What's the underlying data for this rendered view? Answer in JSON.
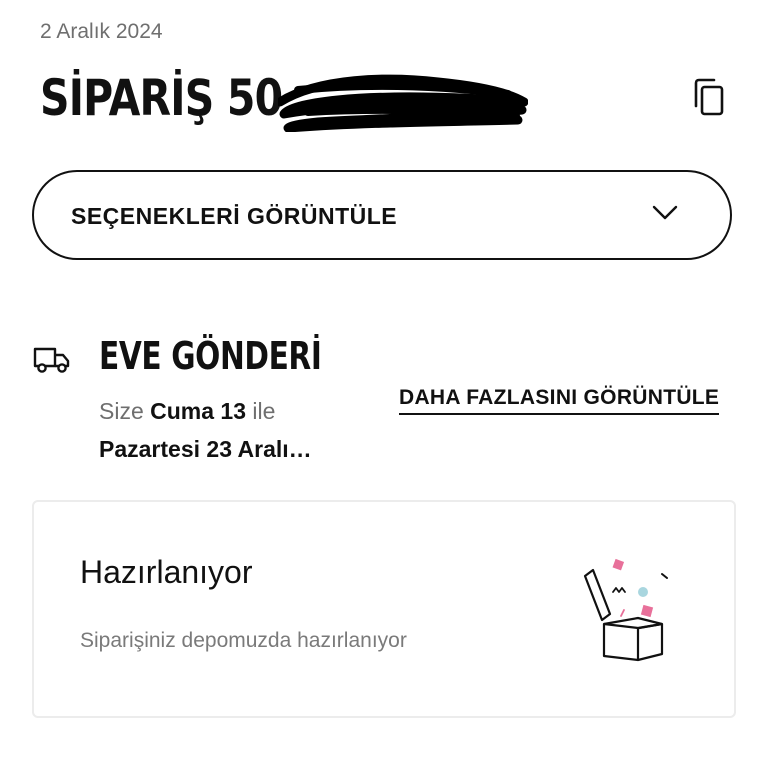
{
  "order": {
    "date": "2 Aralık 2024",
    "title": "SİPARİŞ 50"
  },
  "options_select": {
    "label": "SEÇENEKLERİ GÖRÜNTÜLE"
  },
  "delivery": {
    "title": "EVE GÖNDERİ",
    "line1_prefix": "Size ",
    "line1_day": "Cuma 13",
    "line1_suffix": " ile",
    "line2": "Pazartesi 23 Aralı…",
    "more_link": "DAHA FAZLASINI GÖRÜNTÜLE"
  },
  "status": {
    "title": "Hazırlanıyor",
    "description": "Siparişiniz depomuzda hazırlanıyor"
  },
  "icons": {
    "copy": "copy-icon",
    "chevron": "chevron-down-icon",
    "truck": "truck-icon",
    "box": "open-box-icon"
  },
  "colors": {
    "text": "#111111",
    "muted": "#6f6f6f",
    "card_border": "#ececec",
    "confetti_pink": "#e8709a",
    "confetti_blue": "#a9d6df"
  }
}
